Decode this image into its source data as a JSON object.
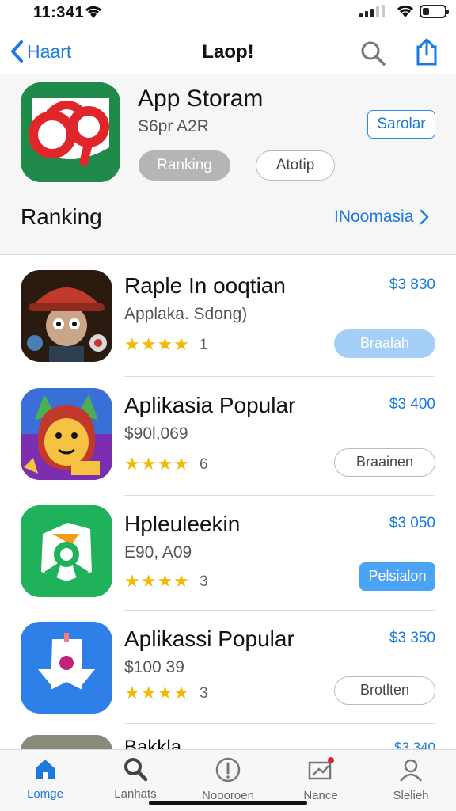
{
  "status_bar": {
    "time": "11:341"
  },
  "nav": {
    "back_label": "Haart",
    "title": "Laop!"
  },
  "header": {
    "app_name": "App Storam",
    "subtitle": "S6pr A2R",
    "primary_chip": "Ranking",
    "secondary_chip": "Atotip",
    "side_button": "Sarolar",
    "section_title": "Ranking",
    "section_link": "INoomasia"
  },
  "apps": [
    {
      "name": "Raple In ooqtian",
      "subtitle": "Applaka. Sdong)",
      "stars": "★★★★",
      "rating_count": "1",
      "price": "$3 830",
      "action": "Braalah"
    },
    {
      "name": "Aplikasia Popular",
      "subtitle": "$90l,069",
      "stars": "★★★★",
      "rating_count": "6",
      "price": "$3 400",
      "action": "Braainen"
    },
    {
      "name": "Hpleuleekin",
      "subtitle": "E90, A09",
      "stars": "★★★★",
      "rating_count": "3",
      "price": "$3 050",
      "action": "Pelsialon"
    },
    {
      "name": "Aplikassi Popular",
      "subtitle": "$100 39",
      "stars": "★★★★",
      "rating_count": "3",
      "price": "$3 350",
      "action": "Brotlten"
    },
    {
      "name": "Bakkla",
      "price": "$3 340"
    }
  ],
  "tabs": [
    {
      "label": "Lomge",
      "icon": "home-icon"
    },
    {
      "label": "Lanhats",
      "icon": "search-icon"
    },
    {
      "label": "Noooroen",
      "icon": "info-circle-icon"
    },
    {
      "label": "Nance",
      "icon": "chart-icon"
    },
    {
      "label": "Slelieh",
      "icon": "person-icon"
    }
  ],
  "colors": {
    "accent": "#1a7ae0",
    "star": "#f5b800",
    "hero_green": "#1f8a4a"
  }
}
